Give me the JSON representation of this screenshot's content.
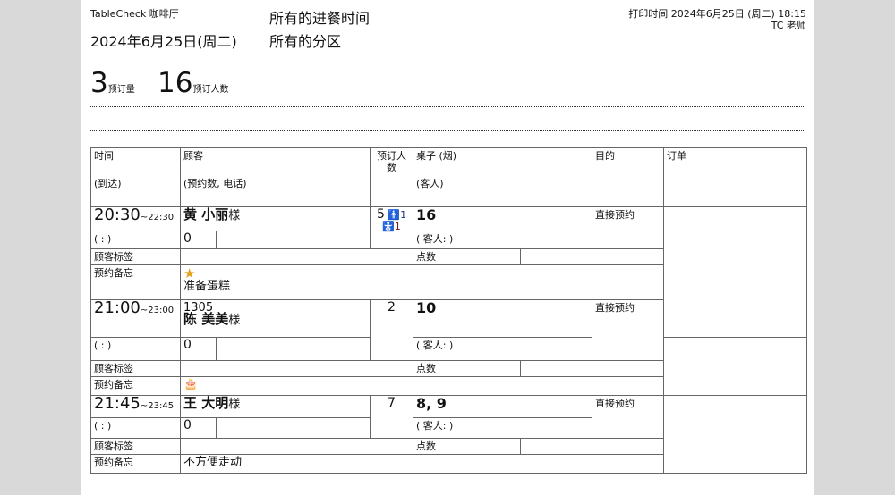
{
  "header": {
    "store": "TableCheck 咖啡厅",
    "date": "2024年6月25日(周二)",
    "filter_time": "所有的进餐时间",
    "filter_zone": "所有的分区",
    "print_time": "打印时间 2024年6月25日 (周二) 18:15",
    "printed_by": "TC 老师"
  },
  "summary": {
    "reservations": "3",
    "reservations_label": "预订量",
    "guests": "16",
    "guests_label": "预订人数"
  },
  "columns": {
    "time": "时间",
    "arrival": "(到达)",
    "customer": "顾客",
    "customer_sub": "(预约数, 电话)",
    "party_size": "预订人数",
    "table": "桌子 (烟)",
    "table_sub": "(客人)",
    "purpose": "目的",
    "order": "订单"
  },
  "row_labels": {
    "customer_tags": "顾客标签",
    "memo": "预约备忘",
    "points": "点数",
    "guest_placeholder": "( 客人:        )",
    "arrival_placeholder": "(      :      )",
    "name_suffix": "様"
  },
  "reservations": [
    {
      "start": "20:30",
      "end": "~22:30",
      "name": "黄 小丽",
      "count": "0",
      "party": "5",
      "adults": "1",
      "kids": "1",
      "table": "16",
      "purpose": "直接预约",
      "memo_icon": "star-icon",
      "memo": "准备蛋糕"
    },
    {
      "start": "21:00",
      "end": "~23:00",
      "customer_no": "1305",
      "name": "陈 美美",
      "count": "0",
      "party": "2",
      "table": "10",
      "purpose": "直接预约",
      "memo_icon": "cake-icon"
    },
    {
      "start": "21:45",
      "end": "~23:45",
      "name": "王 大明",
      "count": "0",
      "party": "7",
      "table": "8, 9",
      "purpose": "直接预约",
      "memo": "不方便走动"
    }
  ]
}
